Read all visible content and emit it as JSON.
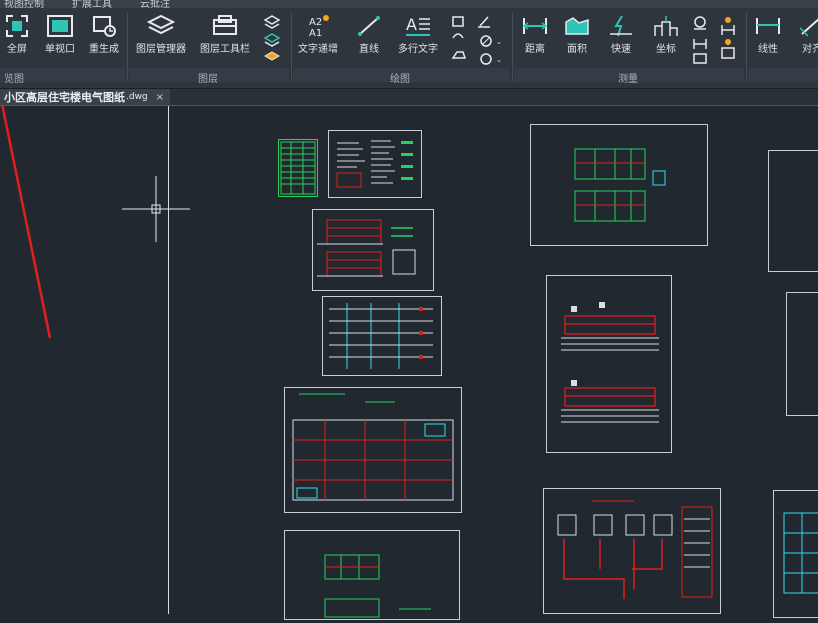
{
  "top_tabs": [
    "视图控制",
    "扩展工具",
    "云批注"
  ],
  "ribbon": {
    "buttons": [
      {
        "label": "全屏",
        "icon": "fullscreen-icon"
      },
      {
        "label": "单视口",
        "icon": "single-viewport-icon"
      },
      {
        "label": "重生成",
        "icon": "regenerate-icon"
      },
      {
        "label": "图层管理器",
        "icon": "layer-manager-icon"
      },
      {
        "label": "图层工具栏",
        "icon": "layer-toolbar-icon"
      },
      {
        "label": "文字递增",
        "icon": "text-increment-icon"
      },
      {
        "label": "直线",
        "icon": "line-icon"
      },
      {
        "label": "多行文字",
        "icon": "multiline-text-icon"
      },
      {
        "label": "距离",
        "icon": "distance-icon"
      },
      {
        "label": "面积",
        "icon": "area-icon"
      },
      {
        "label": "快速",
        "icon": "quick-measure-icon"
      },
      {
        "label": "坐标",
        "icon": "coordinate-icon"
      },
      {
        "label": "线性",
        "icon": "linear-dimension-icon"
      },
      {
        "label": "对齐",
        "icon": "aligned-dimension-icon"
      }
    ],
    "groups": [
      "览图",
      "图层",
      "绘图",
      "测量"
    ]
  },
  "document": {
    "tab_name": "小区高层住宅楼电气图纸",
    "tab_ext": ".dwg",
    "close_symbol": "×"
  },
  "colors": {
    "canvas_bg": "#212830",
    "ribbon_bg": "#2f353d",
    "accent_red": "#e0201c",
    "drawing_green": "#25d35a",
    "drawing_cyan": "#2ee0e8"
  }
}
